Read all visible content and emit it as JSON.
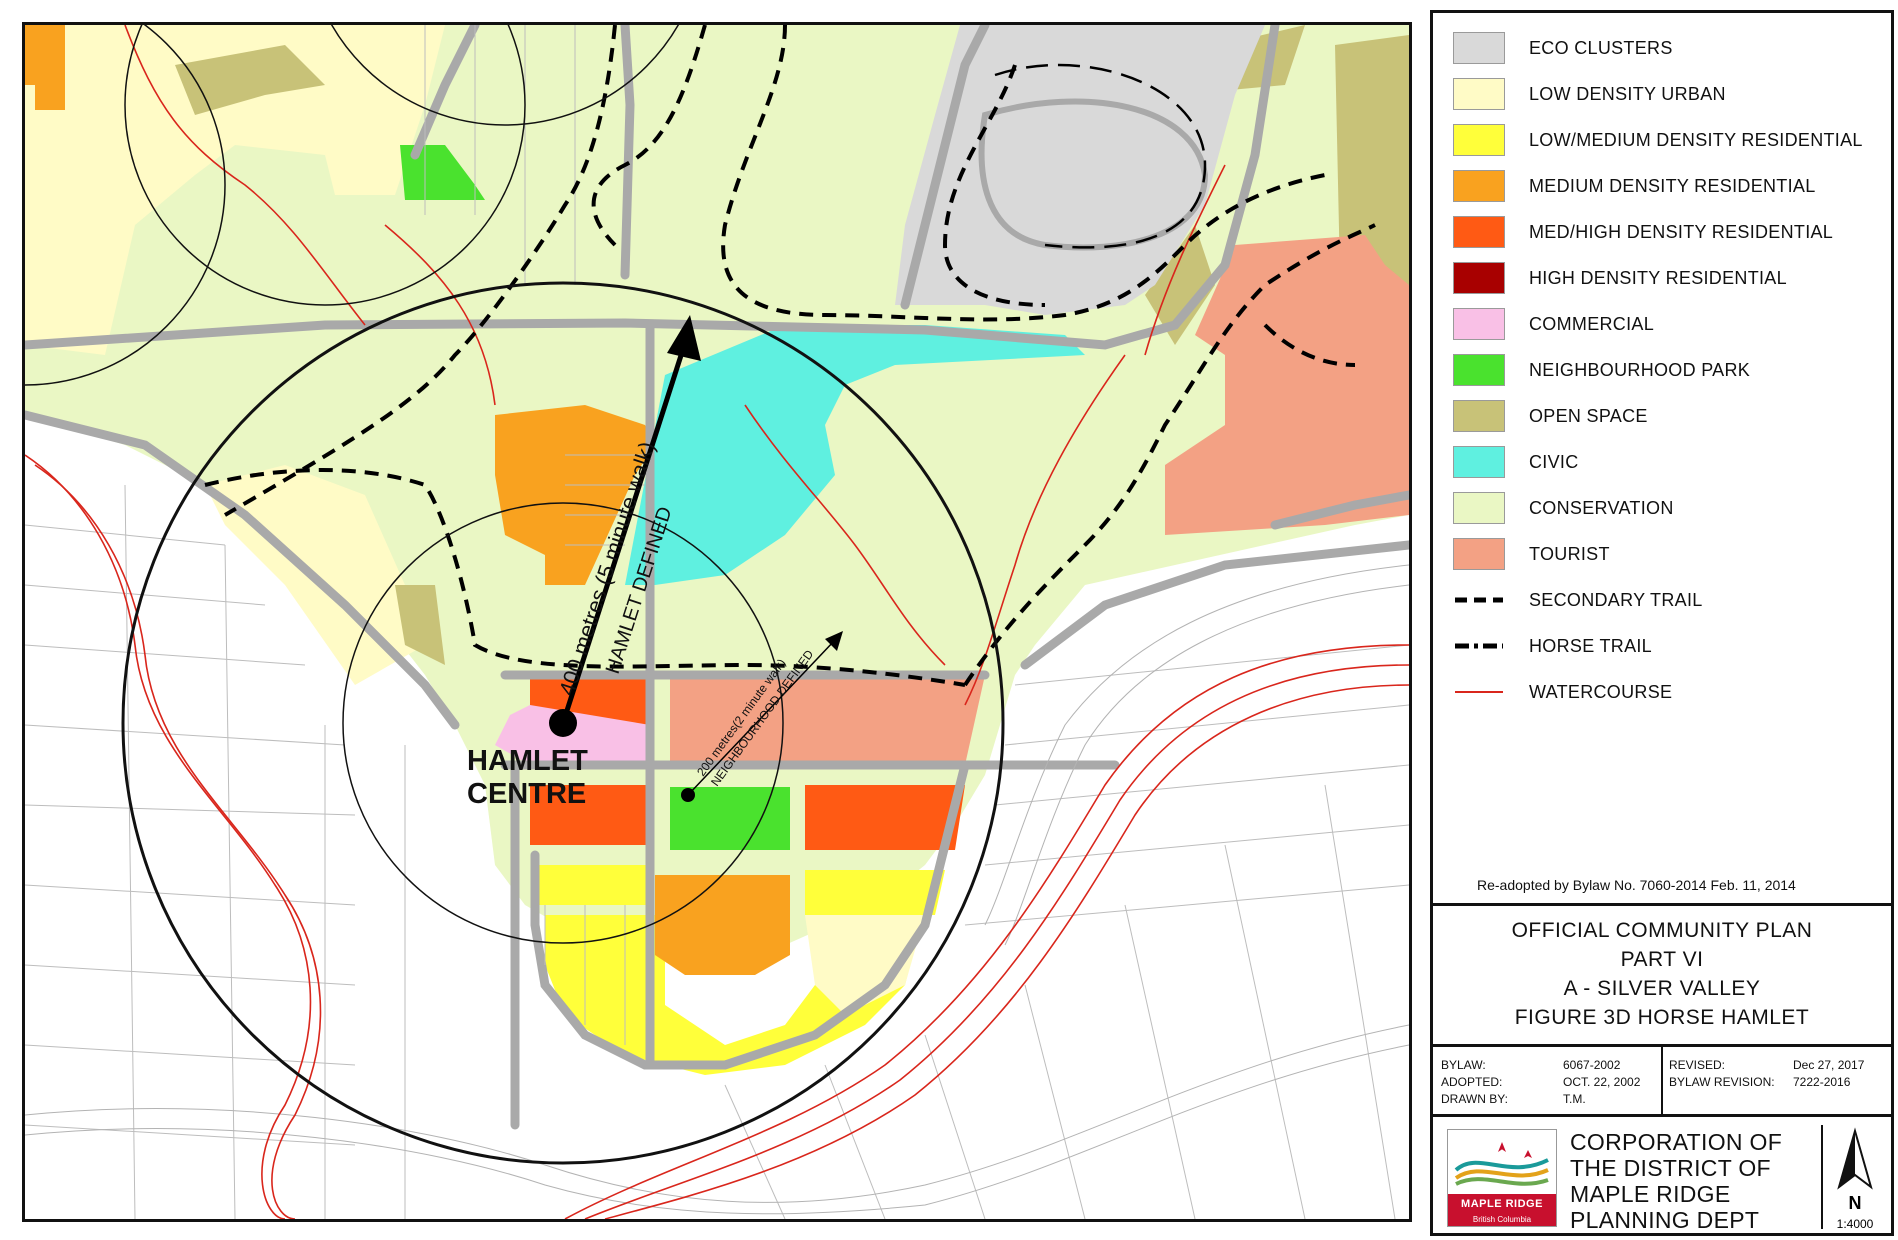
{
  "legend": {
    "items": [
      {
        "label": "ECO CLUSTERS",
        "type": "fill",
        "color": "#d9d9d9"
      },
      {
        "label": "LOW DENSITY URBAN",
        "type": "fill",
        "color": "#fffbc6"
      },
      {
        "label": "LOW/MEDIUM DENSITY RESIDENTIAL",
        "type": "fill",
        "color": "#ffff3a"
      },
      {
        "label": "MEDIUM DENSITY RESIDENTIAL",
        "type": "fill",
        "color": "#f9a21f"
      },
      {
        "label": "MED/HIGH DENSITY RESIDENTIAL",
        "type": "fill",
        "color": "#ff5a14"
      },
      {
        "label": "HIGH DENSITY RESIDENTIAL",
        "type": "fill",
        "color": "#a80000"
      },
      {
        "label": "COMMERCIAL",
        "type": "fill",
        "color": "#f9c0e6"
      },
      {
        "label": "NEIGHBOURHOOD PARK",
        "type": "fill",
        "color": "#4ae22e"
      },
      {
        "label": "OPEN SPACE",
        "type": "fill",
        "color": "#c8c278"
      },
      {
        "label": "CIVIC",
        "type": "fill",
        "color": "#5ff0e0"
      },
      {
        "label": "CONSERVATION",
        "type": "fill",
        "color": "#eaf7c4"
      },
      {
        "label": "TOURIST",
        "type": "fill",
        "color": "#f3a184"
      },
      {
        "label": "SECONDARY TRAIL",
        "type": "dash",
        "color": "#000000"
      },
      {
        "label": "HORSE TRAIL",
        "type": "dashdot",
        "color": "#000000"
      },
      {
        "label": "WATERCOURSE",
        "type": "line",
        "color": "#d9261c"
      }
    ]
  },
  "readopted": "Re-adopted by Bylaw No. 7060-2014  Feb. 11, 2014",
  "title": {
    "lines": [
      "OFFICIAL COMMUNITY PLAN",
      "PART VI",
      "A - SILVER VALLEY",
      "FIGURE 3D HORSE HAMLET"
    ]
  },
  "info": {
    "bylaw_label": "BYLAW:",
    "bylaw_value": "6067-2002",
    "adopted_label": "ADOPTED:",
    "adopted_value": "OCT. 22, 2002",
    "drawn_label": "DRAWN BY:",
    "drawn_value": "T.M.",
    "revised_label": "REVISED:",
    "revised_value": "Dec 27, 2017",
    "bylaw_rev_label": "BYLAW REVISION:",
    "bylaw_rev_value": "7222-2016"
  },
  "brand": {
    "logo_text": "MAPLE RIDGE",
    "logo_sub": "British Columbia",
    "corp_lines": [
      "CORPORATION OF",
      "THE DISTRICT OF",
      "MAPLE RIDGE",
      "PLANNING DEPT"
    ],
    "north": "N",
    "scale": "1:4000"
  },
  "map": {
    "hamlet_line1": "HAMLET",
    "hamlet_line2": "CENTRE",
    "radius400_label": "400 metres (5 minute walk)",
    "radius400_sub": "HAMLET DEFINED",
    "radius200_label": "200 metres(2 minute walk)",
    "radius200_sub": "NEIGHBOURHOOD DEFINED"
  }
}
